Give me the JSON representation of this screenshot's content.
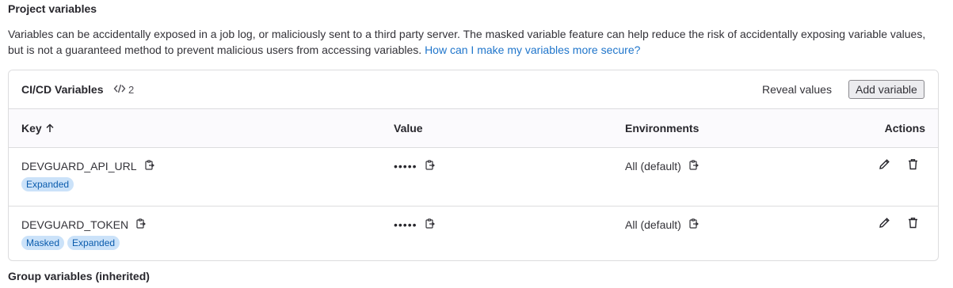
{
  "page": {
    "section_title": "Project variables",
    "description": "Variables can be accidentally exposed in a job log, or maliciously sent to a third party server. The masked variable feature can help reduce the risk of accidentally exposing variable values, but is not a guaranteed method to prevent malicious users from accessing variables.",
    "help_link": "How can I make my variables more secure?",
    "group_section_title": "Group variables (inherited)"
  },
  "card": {
    "title": "CI/CD Variables",
    "count": "2",
    "reveal_label": "Reveal values",
    "add_label": "Add variable"
  },
  "table": {
    "headers": {
      "key": "Key",
      "value": "Value",
      "environments": "Environments",
      "actions": "Actions"
    },
    "rows": [
      {
        "key": "DEVGUARD_API_URL",
        "value": "•••••",
        "environment": "All (default)",
        "badges": [
          "Expanded"
        ]
      },
      {
        "key": "DEVGUARD_TOKEN",
        "value": "•••••",
        "environment": "All (default)",
        "badges": [
          "Masked",
          "Expanded"
        ]
      }
    ]
  },
  "icons": {
    "count": "code-icon",
    "sort": "arrow-up-icon",
    "copy": "copy-to-clipboard-icon",
    "edit": "pencil-icon",
    "delete": "trash-icon"
  },
  "colors": {
    "link": "#1f75cb",
    "badge_bg": "#cbe2f9",
    "badge_text": "#0b5cad",
    "border": "#dcdcde"
  }
}
